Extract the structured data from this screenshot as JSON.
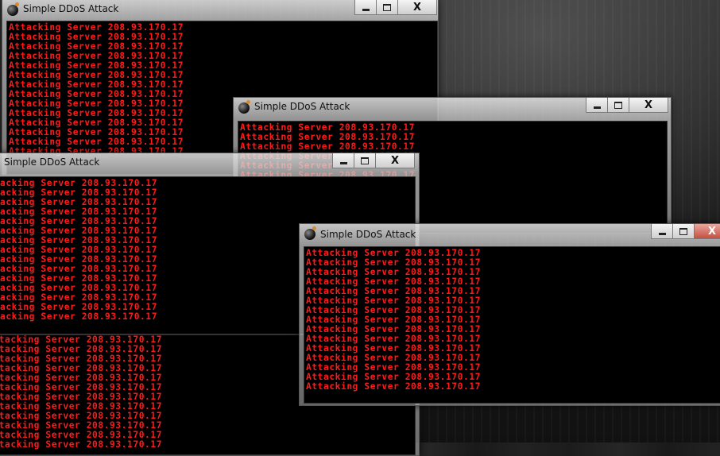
{
  "windows": {
    "title": "Simple DDoS Attack",
    "line": "Attacking Server 208.93.170.17"
  },
  "controls": {
    "close_glyph": "X"
  },
  "colors": {
    "console_text": "#ff1a1a",
    "console_bg": "#000000"
  }
}
